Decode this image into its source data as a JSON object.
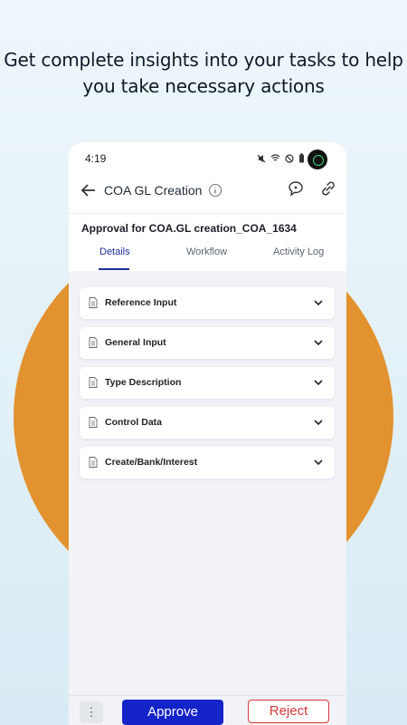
{
  "headline": "Get complete insights into your tasks to help you take necessary actions",
  "status_bar": {
    "time": "4:19"
  },
  "app_bar": {
    "title": "COA GL Creation"
  },
  "page_title": "Approval for COA.GL creation_COA_1634",
  "tabs": [
    {
      "label": "Details",
      "active": true
    },
    {
      "label": "Workflow",
      "active": false
    },
    {
      "label": "Activity Log",
      "active": false
    }
  ],
  "sections": [
    {
      "label": "Reference Input"
    },
    {
      "label": "General Input"
    },
    {
      "label": "Type Description"
    },
    {
      "label": "Control Data"
    },
    {
      "label": "Create/Bank/Interest"
    }
  ],
  "actions": {
    "more": "⋮",
    "approve": "Approve",
    "reject": "Reject"
  },
  "colors": {
    "accent": "#1424c9",
    "reject": "#d93a3a",
    "circle": "#e2922f"
  },
  "icons": [
    "back-arrow-icon",
    "info-icon",
    "chat-icon",
    "link-icon",
    "document-icon",
    "chevron-down-icon"
  ]
}
